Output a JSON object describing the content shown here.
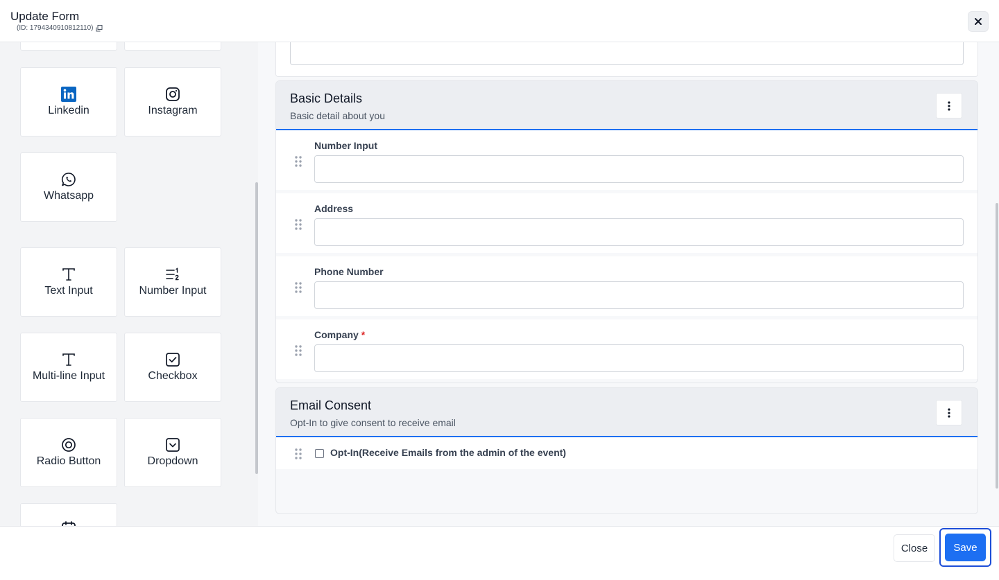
{
  "header": {
    "title": "Update Form",
    "id_text": "(ID: 1794340910812110)"
  },
  "palette": {
    "tiles": [
      {
        "label": "Linkedin",
        "icon": "linkedin-icon"
      },
      {
        "label": "Instagram",
        "icon": "instagram-icon"
      },
      {
        "label": "Whatsapp",
        "icon": "whatsapp-icon"
      },
      {
        "label": "Text Input",
        "icon": "text-icon"
      },
      {
        "label": "Number Input",
        "icon": "number-list-icon"
      },
      {
        "label": "Multi-line Input",
        "icon": "text-icon"
      },
      {
        "label": "Checkbox",
        "icon": "checkbox-icon"
      },
      {
        "label": "Radio Button",
        "icon": "radio-icon"
      },
      {
        "label": "Dropdown",
        "icon": "dropdown-icon"
      }
    ]
  },
  "sections": [
    {
      "title": "Basic Details",
      "description": "Basic detail about you",
      "fields": [
        {
          "label": "Number Input",
          "required": false,
          "value": ""
        },
        {
          "label": "Address",
          "required": false,
          "value": ""
        },
        {
          "label": "Phone Number",
          "required": false,
          "value": ""
        },
        {
          "label": "Company",
          "required": true,
          "required_mark": "*",
          "value": ""
        }
      ]
    },
    {
      "title": "Email Consent",
      "description": "Opt-In to give consent to receive email",
      "fields": [
        {
          "label": "Opt-In(Receive Emails from the admin of the event)",
          "type": "checkbox",
          "checked": false
        }
      ]
    }
  ],
  "footer": {
    "close_label": "Close",
    "save_label": "Save"
  },
  "colors": {
    "accent": "#1d6ff2",
    "required": "#dc2626",
    "linkedin": "#0a66c2"
  }
}
